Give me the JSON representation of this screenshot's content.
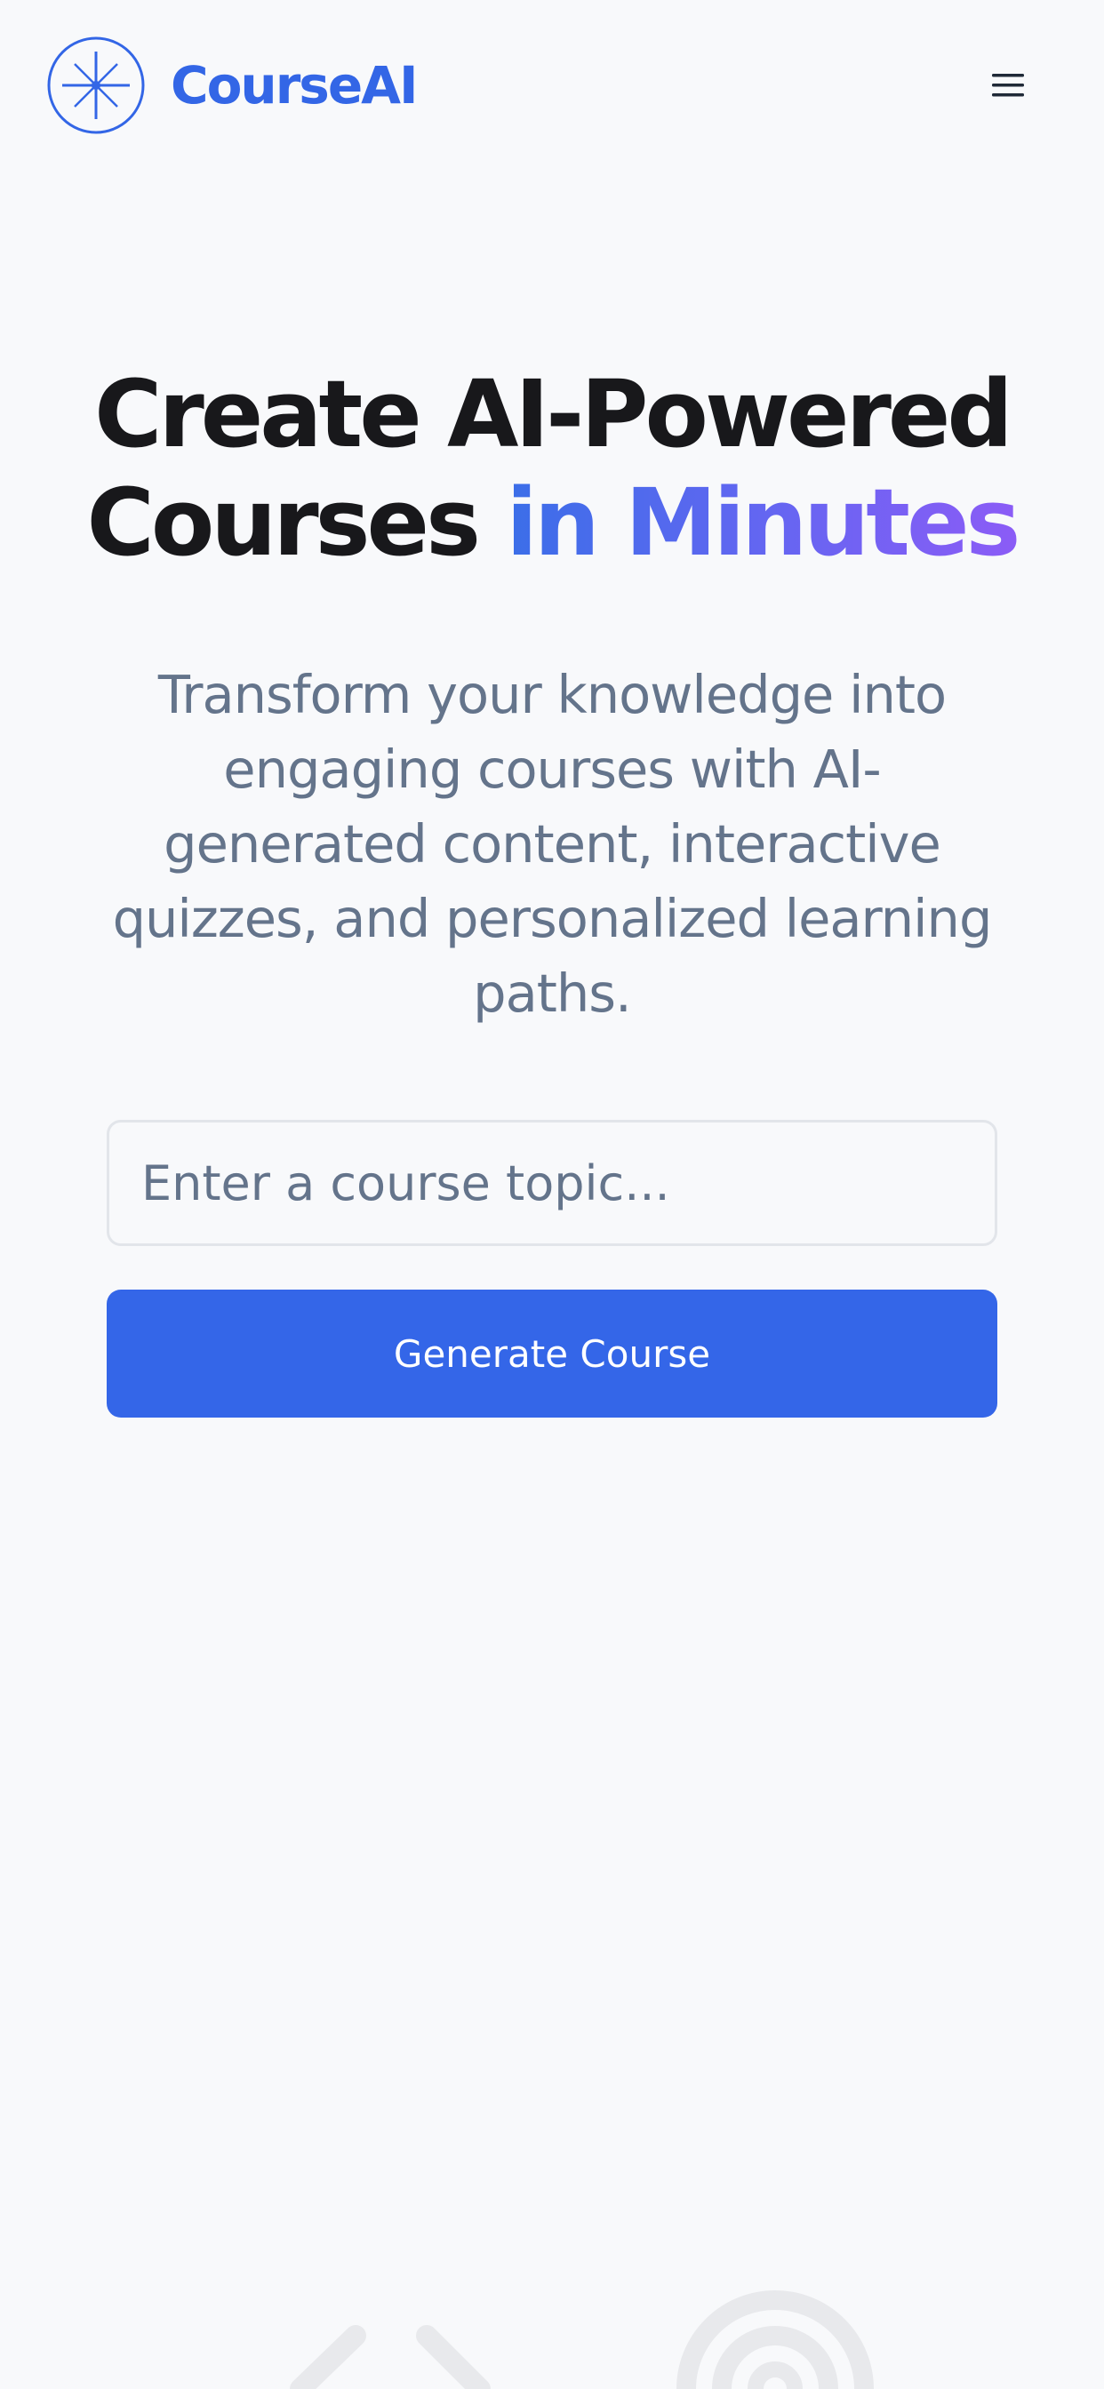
{
  "header": {
    "brand_name": "CourseAI",
    "logo_icon": "asterisk-compass-icon",
    "menu_icon": "hamburger-menu-icon"
  },
  "hero": {
    "title_line1": "Create AI-Powered",
    "title_line2_plain": "Courses ",
    "title_line2_accent": "in Minutes",
    "subtitle": "Transform your knowledge into engaging courses with AI-generated content, interactive quizzes, and personalized learning paths."
  },
  "form": {
    "topic_placeholder": "Enter a course topic...",
    "topic_value": "",
    "generate_label": "Generate Course"
  },
  "decorations": {
    "left_icon": "code-brackets-icon",
    "right_icon": "target-icon"
  },
  "colors": {
    "brand": "#3366e6",
    "accent_gradient_start": "#3b6ee8",
    "accent_gradient_end": "#8b5cf6",
    "button_bg": "#3466e8",
    "background": "#f8f9fb",
    "title_text": "#18181b",
    "muted_text": "#64748b"
  }
}
